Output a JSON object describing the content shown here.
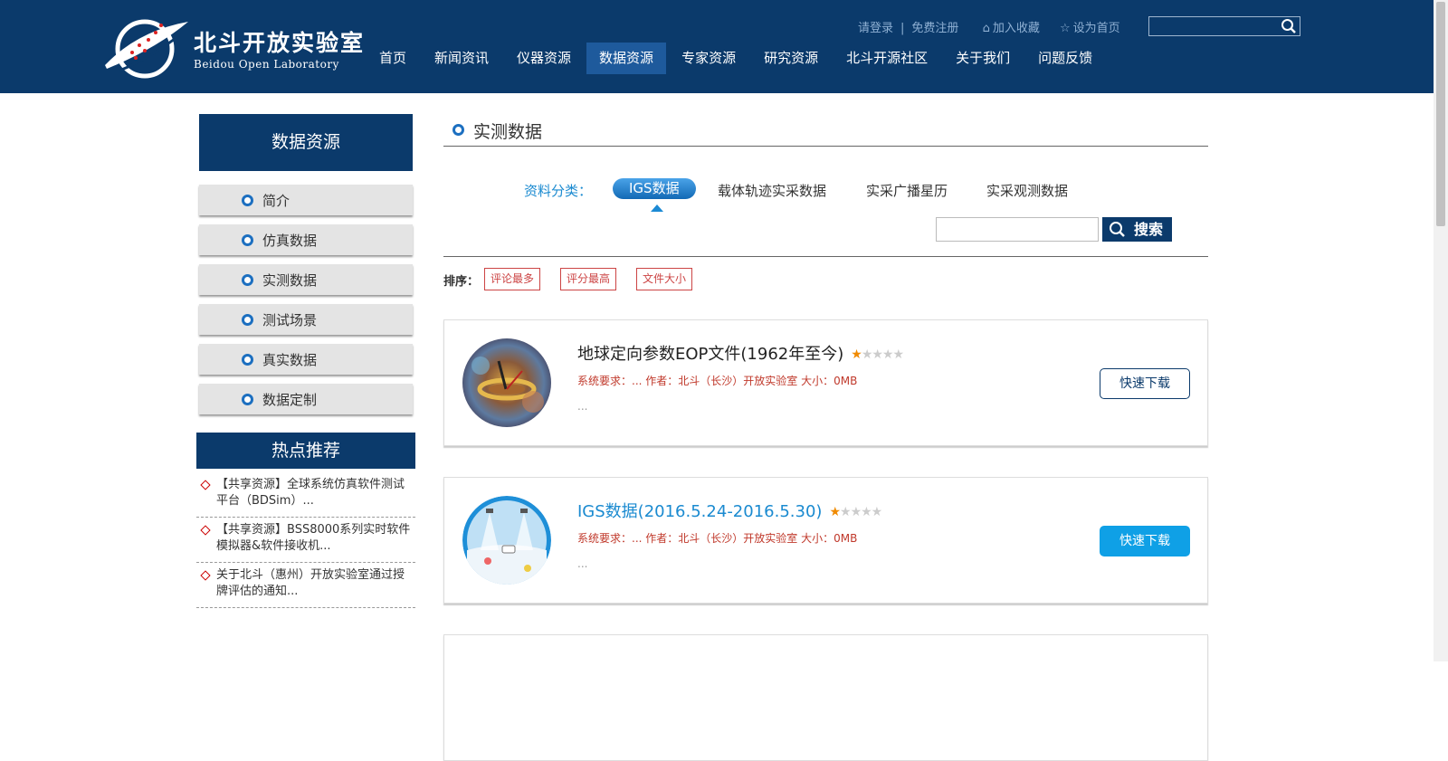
{
  "header": {
    "logo_cn": "北斗开放实验室",
    "logo_en": "Beidou Open Laboratory",
    "top_links": {
      "login": "请登录",
      "register": "免费注册",
      "favorite": "加入收藏",
      "homepage": "设为首页"
    },
    "search": {
      "placeholder": ""
    },
    "nav": [
      "首页",
      "新闻资讯",
      "仪器资源",
      "数据资源",
      "专家资源",
      "研究资源",
      "北斗开源社区",
      "关于我们",
      "问题反馈"
    ],
    "nav_active": "数据资源"
  },
  "sidebar": {
    "title": "数据资源",
    "items": [
      "简介",
      "仿真数据",
      "实测数据",
      "测试场景",
      "真实数据",
      "数据定制"
    ],
    "hot_title": "热点推荐",
    "hot_items": [
      "【共享资源】全球系统仿真软件测试平台（BDSim）...",
      "【共享资源】BSS8000系列实时软件模拟器&软件接收机...",
      "关于北斗（惠州）开放实验室通过授牌评估的通知..."
    ]
  },
  "main": {
    "title": "实测数据",
    "category_label": "资料分类：",
    "categories": [
      "IGS数据",
      "载体轨迹实采数据",
      "实采广播星历",
      "实采观测数据"
    ],
    "category_active": "IGS数据",
    "search_button": "搜索",
    "sort_label": "排序：",
    "sort_options": [
      "评论最多",
      "评分最高",
      "文件大小"
    ],
    "cards": [
      {
        "title": "地球定向参数EOP文件(1962年至今)",
        "rating": 1,
        "meta": "系统要求：... 作者：北斗（长沙）开放实验室 大小：0MB",
        "desc": "...",
        "download": "快速下载"
      },
      {
        "title": "IGS数据(2016.5.24-2016.5.30)",
        "rating": 1,
        "meta": "系统要求：... 作者：北斗（长沙）开放实验室 大小：0MB",
        "desc": "...",
        "download": "快速下载"
      }
    ]
  },
  "colors": {
    "brand": "#0b3a6b",
    "accent": "#1a8ad0",
    "download_active": "#0fa0e6",
    "star": "#f08a00"
  }
}
